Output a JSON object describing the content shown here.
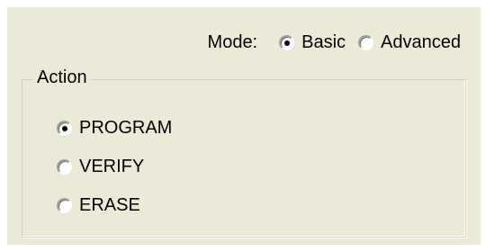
{
  "mode": {
    "label": "Mode:",
    "options": [
      {
        "label": "Basic",
        "checked": true
      },
      {
        "label": "Advanced",
        "checked": false
      }
    ]
  },
  "action_group": {
    "legend": "Action",
    "options": [
      {
        "label": "PROGRAM",
        "checked": true
      },
      {
        "label": "VERIFY",
        "checked": false
      },
      {
        "label": "ERASE",
        "checked": false
      }
    ]
  },
  "colors": {
    "background": "#ece9d8",
    "text": "#000000",
    "group_border": "#d2cfc2"
  }
}
